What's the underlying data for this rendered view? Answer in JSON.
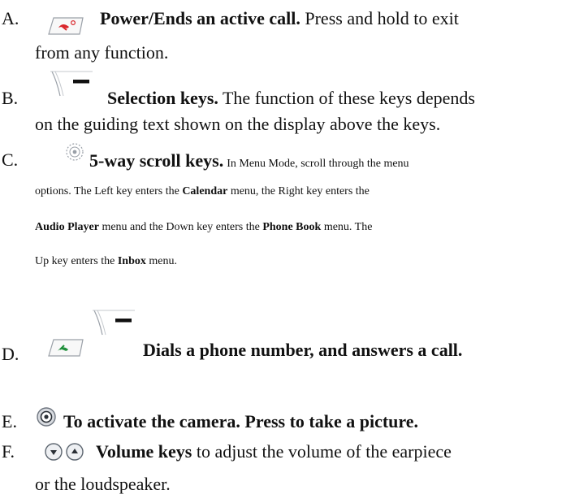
{
  "items": [
    {
      "letter": "A.",
      "icon": "end-call-red-handset-icon",
      "bold": "Power/Ends an active call.",
      "rest": " Press and hold to exit",
      "line2": "from any function."
    },
    {
      "letter": "B.",
      "icon": "selection-key-icon",
      "bold": "Selection keys.",
      "rest": " The function of these keys depends",
      "line2": "on the guiding text shown on the display above the keys."
    },
    {
      "letter": "C.",
      "icon": "scroll-key-icon",
      "bold": "5-way scroll keys.",
      "lines": [
        [
          {
            "t": "In Menu Mode, scroll through the menu",
            "b": false
          }
        ],
        [
          {
            "t": "options. The Left key enters the ",
            "b": false
          },
          {
            "t": "Calendar",
            "b": true
          },
          {
            "t": " menu, the Right key enters the",
            "b": false
          }
        ],
        [
          {
            "t": "Audio Player",
            "b": true
          },
          {
            "t": " menu and the Down key enters the ",
            "b": false
          },
          {
            "t": "Phone Book",
            "b": true
          },
          {
            "t": " menu. The",
            "b": false
          }
        ],
        [
          {
            "t": "Up key enters the ",
            "b": false
          },
          {
            "t": "Inbox",
            "b": true
          },
          {
            "t": " menu.",
            "b": false
          }
        ]
      ]
    },
    {
      "letter": "D.",
      "icons": [
        "send-call-green-handset-icon",
        "selection-key-icon"
      ],
      "bold": "Dials a phone number, and answers a call."
    },
    {
      "letter": "E.",
      "icon": "camera-key-icon",
      "bold": "To activate the camera. Press to take a picture."
    },
    {
      "letter": "F.",
      "icons": [
        "volume-down-icon",
        "volume-up-icon"
      ],
      "bold": "Volume keys",
      "rest": " to adjust the volume of the earpiece",
      "line2": "or the loudspeaker."
    }
  ]
}
